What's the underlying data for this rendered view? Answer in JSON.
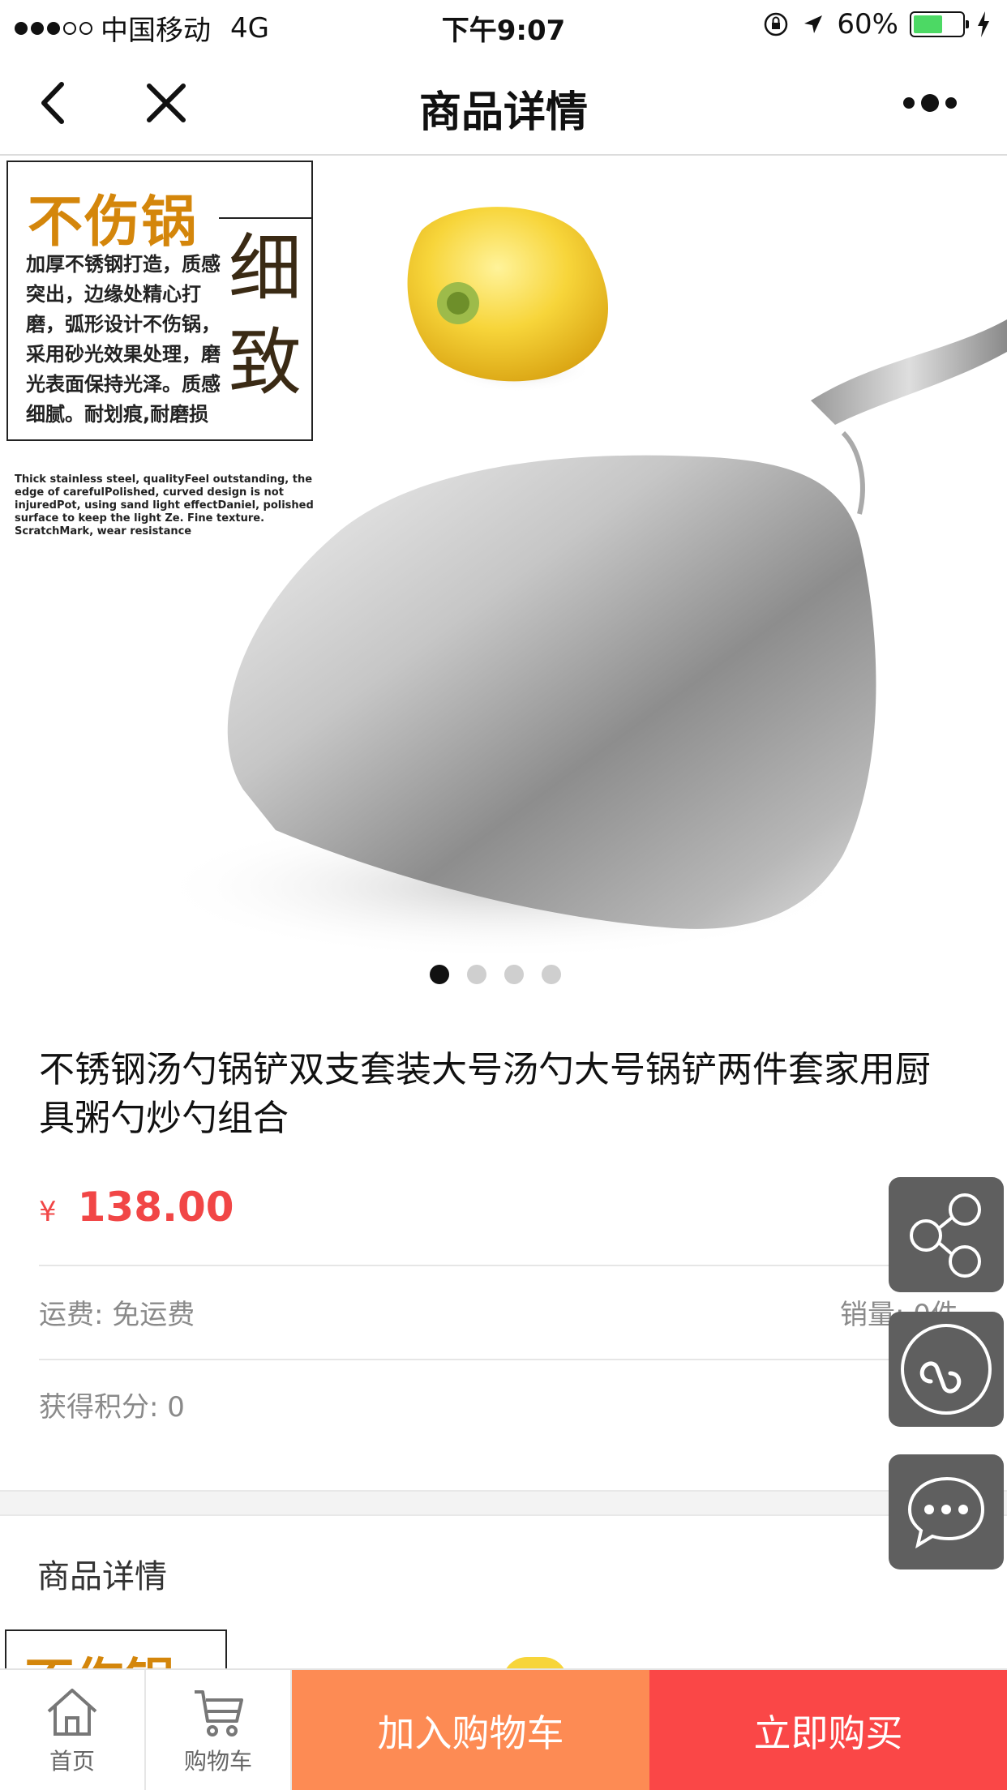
{
  "status_bar": {
    "carrier": "中国移动",
    "network": "4G",
    "time": "下午9:07",
    "battery_percent": "60%",
    "battery_level": 0.6,
    "signal_bars_filled": 3,
    "signal_bars_total": 5
  },
  "nav": {
    "title": "商品详情",
    "icons": [
      "chevron-left-icon",
      "close-icon",
      "more-dots-icon"
    ]
  },
  "banner": {
    "promo_title": "不伤锅",
    "promo_text": "加厚不锈钢打造，质感突出，边缘处精心打磨，弧形设计不伤锅，采用砂光效果处理，磨光表面保持光泽。质感细腻。耐划痕,耐磨损",
    "promo_big_1": "细",
    "promo_big_2": "致",
    "promo_en": "Thick stainless steel, qualityFeel outstanding, the edge of carefulPolished, curved design is not injuredPot, using sand light effectDaniel, polished surface to keep the light Ze. Fine texture. ScratchMark, wear resistance",
    "slide_count": 4,
    "active_slide": 1
  },
  "product": {
    "title": " 不锈钢汤勺锅铲双支套装大号汤勺大号锅铲两件套家用厨具粥勺炒勺组合",
    "currency_symbol": "¥",
    "price": "138.00",
    "shipping": "运费: 免运费",
    "sales": "销量: 0件",
    "points": "获得积分: 0"
  },
  "detail": {
    "heading": "商品详情",
    "peek_title": "不伤锅"
  },
  "floating": {
    "icons": [
      "share-icon",
      "mini-program-link-icon",
      "chat-bubble-icon"
    ]
  },
  "bottom_bar": {
    "home_label": "首页",
    "cart_label": "购物车",
    "add_to_cart": "加入购物车",
    "buy_now": "立即购买"
  },
  "colors": {
    "price_red": "#f14646",
    "cart_orange": "#fd8b54",
    "buy_red": "#fa4747",
    "promo_gold": "#d4860b",
    "battery_green": "#4cd964"
  }
}
